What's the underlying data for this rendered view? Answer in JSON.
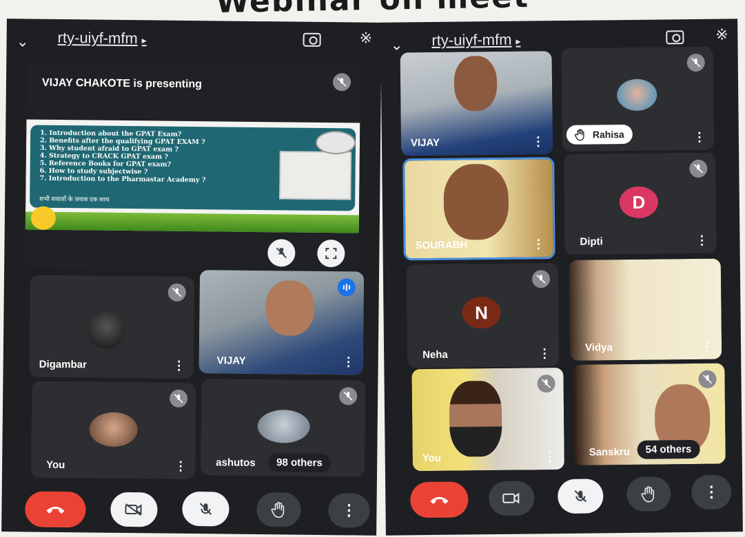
{
  "banner_title": "Webinar on  meet",
  "left": {
    "meeting_code": "rty-uiyf-mfm",
    "presenting_label": "VIJAY CHAKOTE is presenting",
    "slide": {
      "lines": [
        "1. Introduction about the GPAT Exam?",
        "2. Benefits after the qualifying  GPAT EXAM ?",
        "3. Why student afraid to GPAT exam ?",
        "4. Strategy to CRACK GPAT exam ?",
        "5. Reference Books for GPAT exam?",
        "6. How to study subjectwise ?",
        "7. Introduction to the Pharmastar Academy ?"
      ],
      "hindi": "सभी सवालों के जवाब एक साथ"
    },
    "participants": [
      {
        "name": "Digambar"
      },
      {
        "name": "VIJAY"
      },
      {
        "name": "You"
      },
      {
        "name": "ashutos"
      }
    ],
    "others_count": "98 others"
  },
  "right": {
    "meeting_code": "rty-uiyf-mfm",
    "participants": [
      {
        "name": "VIJAY"
      },
      {
        "name": "Rahisa"
      },
      {
        "name": "SOURABH"
      },
      {
        "name": "Dipti",
        "initial": "D"
      },
      {
        "name": "Neha",
        "initial": "N"
      },
      {
        "name": "Vidya"
      },
      {
        "name": "You"
      },
      {
        "name": "Sanskru"
      }
    ],
    "others_count": "54 others"
  },
  "colors": {
    "accent_blue": "#1a73e8",
    "end_call_red": "#ea4335",
    "dipti_avatar": "#d93864",
    "neha_avatar": "#7a2a14"
  },
  "icons": [
    "chevron-down-icon",
    "camera-switch-icon",
    "bluetooth-icon",
    "mic-off-icon",
    "raise-hand-icon",
    "end-call-icon",
    "camera-off-icon",
    "camera-icon",
    "more-vert-icon",
    "fullscreen-icon",
    "audio-level-icon"
  ]
}
